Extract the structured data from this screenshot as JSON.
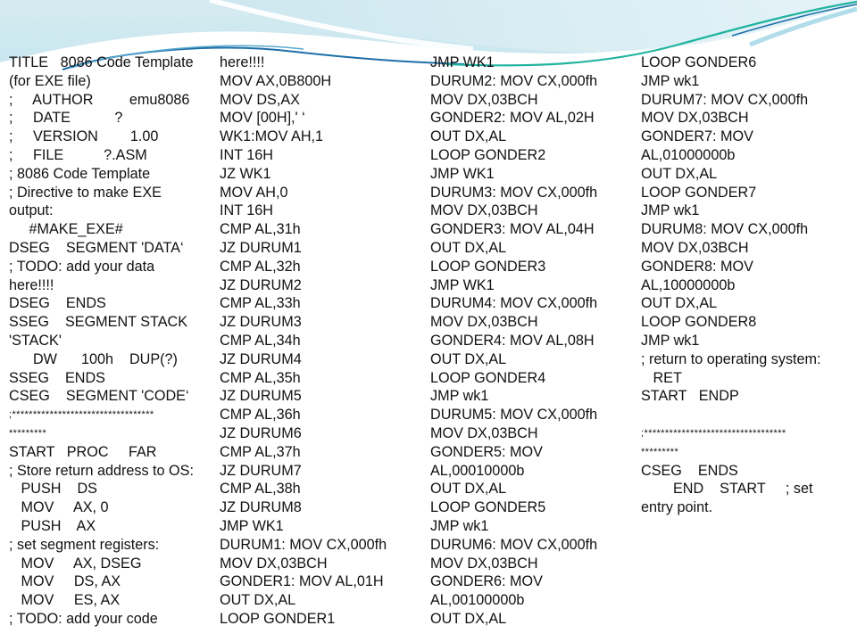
{
  "slide": {
    "columns": [
      {
        "lines": [
          "TITLE   8086 Code Template",
          "(for EXE file)",
          ";     AUTHOR         emu8086",
          ";     DATE           ?",
          ";     VERSION        1.00",
          ";     FILE          ?.ASM",
          "; 8086 Code Template",
          "; Directive to make EXE",
          "output:",
          "     #MAKE_EXE#",
          "DSEG    SEGMENT 'DATA‘",
          "; TODO: add your data",
          "here!!!!",
          "DSEG    ENDS",
          "SSEG    SEGMENT STACK",
          "'STACK'",
          "      DW      100h    DUP(?)",
          "SSEG    ENDS",
          "CSEG    SEGMENT 'CODE‘",
          ";**********************************",
          "*********",
          "START   PROC     FAR",
          "; Store return address to OS:",
          "   PUSH    DS",
          "   MOV     AX, 0",
          "   PUSH    AX",
          "; set segment registers:",
          "   MOV     AX, DSEG",
          "   MOV     DS, AX",
          "   MOV     ES, AX",
          "; TODO: add your code"
        ]
      },
      {
        "lines": [
          "here!!!!",
          "MOV AX,0B800H",
          "MOV DS,AX",
          "MOV [00H],' ‘",
          "WK1:MOV AH,1",
          "INT 16H",
          "JZ WK1",
          "MOV AH,0",
          "INT 16H",
          "CMP AL,31h",
          "JZ DURUM1",
          "CMP AL,32h",
          "JZ DURUM2",
          "CMP AL,33h",
          "JZ DURUM3",
          "CMP AL,34h",
          "JZ DURUM4",
          "CMP AL,35h",
          "JZ DURUM5",
          "CMP AL,36h",
          "JZ DURUM6",
          "CMP AL,37h",
          "JZ DURUM7",
          "CMP AL,38h",
          "JZ DURUM8",
          "JMP WK1",
          "DURUM1: MOV CX,000fh",
          "MOV DX,03BCH",
          "GONDER1: MOV AL,01H",
          "OUT DX,AL",
          "LOOP GONDER1"
        ]
      },
      {
        "lines": [
          "JMP WK1",
          "DURUM2: MOV CX,000fh",
          "MOV DX,03BCH",
          "GONDER2: MOV AL,02H",
          "OUT DX,AL",
          "LOOP GONDER2",
          "JMP WK1",
          "DURUM3: MOV CX,000fh",
          "MOV DX,03BCH",
          "GONDER3: MOV AL,04H",
          "OUT DX,AL",
          "LOOP GONDER3",
          "JMP WK1",
          "DURUM4: MOV CX,000fh",
          "MOV DX,03BCH",
          "GONDER4: MOV AL,08H",
          "OUT DX,AL",
          "LOOP GONDER4",
          "JMP wk1",
          "DURUM5: MOV CX,000fh",
          "MOV DX,03BCH",
          "GONDER5: MOV",
          "AL,00010000b",
          "OUT DX,AL",
          "LOOP GONDER5",
          "JMP wk1",
          "DURUM6: MOV CX,000fh",
          "MOV DX,03BCH",
          "GONDER6: MOV",
          "AL,00100000b",
          "OUT DX,AL"
        ]
      },
      {
        "lines": [
          "LOOP GONDER6",
          "JMP wk1",
          "DURUM7: MOV CX,000fh",
          "MOV DX,03BCH",
          "GONDER7: MOV",
          "AL,01000000b",
          "OUT DX,AL",
          "LOOP GONDER7",
          "JMP wk1",
          "DURUM8: MOV CX,000fh",
          "MOV DX,03BCH",
          "GONDER8: MOV",
          "AL,10000000b",
          "OUT DX,AL",
          "LOOP GONDER8",
          "JMP wk1",
          "; return to operating system:",
          "   RET",
          "START   ENDP",
          "",
          ";**********************************",
          "*********",
          "CSEG    ENDS",
          "        END    START     ; set",
          "entry point."
        ]
      }
    ]
  },
  "theme": {
    "wave_light": "#cfe9f1",
    "wave_mid": "#a9d9e6",
    "wave_dark": "#1d6fa8",
    "wave_teal": "#20b3a0",
    "text": "#111111"
  }
}
